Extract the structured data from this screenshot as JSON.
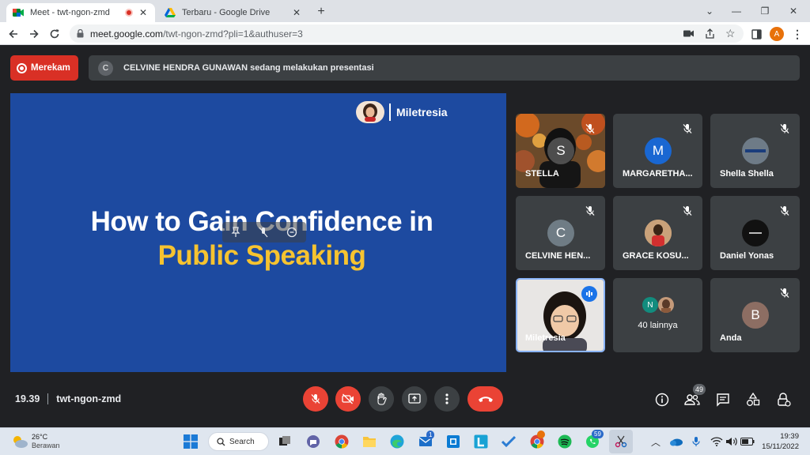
{
  "browser": {
    "tabs": [
      {
        "title": "Meet - twt-ngon-zmd",
        "active": true
      },
      {
        "title": "Terbaru - Google Drive",
        "active": false
      }
    ],
    "url_host": "meet.google.com",
    "url_path": "/twt-ngon-zmd?pli=1&authuser=3",
    "profile_initial": "A"
  },
  "meet": {
    "record_label": "Merekam",
    "presenter_initial": "C",
    "presenting_text": "CELVINE HENDRA GUNAWAN sedang melakukan presentasi",
    "slide": {
      "brand": "Miletresia",
      "title_line1": "How to Gain Confidence in",
      "title_line2": "Public Speaking",
      "title_line1_color": "#ffffff",
      "title_line2_color": "#f6c330",
      "background_color": "#1d4aa0"
    },
    "participants": [
      {
        "name": "STELLA",
        "initial": "S",
        "muted": true
      },
      {
        "name": "MARGARETHA...",
        "initial": "M",
        "muted": true,
        "color": "#1967d2"
      },
      {
        "name": "Shella Shella",
        "muted": true
      },
      {
        "name": "CELVINE HEN...",
        "initial": "C",
        "muted": true,
        "color": "#5f6368"
      },
      {
        "name": "GRACE KOSU...",
        "muted": true
      },
      {
        "name": "Daniel Yonas",
        "muted": true
      },
      {
        "name": "Miletresia",
        "muted": false,
        "speaking": true
      },
      {
        "name": "40 lainnya",
        "initial": "N"
      },
      {
        "name": "Anda",
        "initial": "B",
        "muted": true,
        "color": "#8d6e63"
      }
    ],
    "time": "19.39",
    "meeting_code": "twt-ngon-zmd",
    "people_count": "49"
  },
  "taskbar": {
    "weather_temp": "26°C",
    "weather_desc": "Berawan",
    "search_label": "Search",
    "mail_badge": "1",
    "whatsapp_badge": "59",
    "clock_time": "19:39",
    "clock_date": "15/11/2022"
  }
}
